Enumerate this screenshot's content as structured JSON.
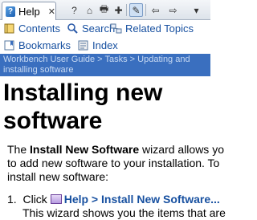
{
  "view_tab": {
    "label": "Help",
    "close": "✕"
  },
  "toolbar": {
    "buttons": [
      {
        "name": "show-in-all-topics-button",
        "glyph": "?"
      },
      {
        "name": "home-button",
        "glyph": "⌂"
      },
      {
        "name": "print-button",
        "glyph": "🖶"
      },
      {
        "name": "bookmark-document-button",
        "glyph": "✚"
      },
      {
        "name": "highlight-search-terms-button",
        "glyph": "✎"
      },
      {
        "name": "back-button",
        "glyph": "⇦"
      },
      {
        "name": "forward-button",
        "glyph": "⇨"
      },
      {
        "name": "view-menu-button",
        "glyph": "▾"
      }
    ]
  },
  "nav": {
    "contents": "Contents",
    "search": "Search",
    "related_topics": "Related Topics",
    "bookmarks": "Bookmarks",
    "index": "Index"
  },
  "breadcrumb": {
    "part1": "Workbench User Guide",
    "sep1": " > ",
    "part2": "Tasks",
    "sep2": " > ",
    "part3": "Updating and installing software"
  },
  "content": {
    "title_line1": "Installing new",
    "title_line2": "software",
    "para_the": "The ",
    "para_bold": "Install New Software",
    "para_line1_rest": " wizard allows yo",
    "para_line2": "to add new software to your installation. To",
    "para_line3": "install new software:",
    "step_number": "1.",
    "step_click": "Click ",
    "step_link": "Help > Install New Software...",
    "step_desc": "This wizard shows you the items that are"
  }
}
